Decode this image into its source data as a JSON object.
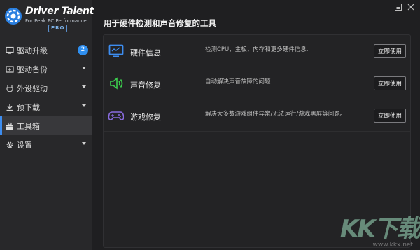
{
  "app": {
    "name": "Driver Talent",
    "tagline": "For Peak PC Performance",
    "edition": "PRO"
  },
  "titlebar": {
    "menu_icon": "menu-icon",
    "close_icon": "close-icon"
  },
  "sidebar": {
    "items": [
      {
        "label": "驱动升级",
        "icon": "monitor-icon",
        "badge": "2",
        "active": false
      },
      {
        "label": "驱动备份",
        "icon": "backup-icon",
        "caret": true,
        "active": false
      },
      {
        "label": "外设驱动",
        "icon": "plug-icon",
        "caret": true,
        "active": false
      },
      {
        "label": "预下载",
        "icon": "download-icon",
        "caret": true,
        "active": false
      },
      {
        "label": "工具箱",
        "icon": "toolbox-icon",
        "active": true
      },
      {
        "label": "设置",
        "icon": "gear-icon",
        "caret": true,
        "active": false
      }
    ]
  },
  "main": {
    "title": "用于硬件检测和声音修复的工具",
    "tools": [
      {
        "name": "硬件信息",
        "desc": "检测CPU，主板，内存和更多硬件信息.",
        "button": "立即使用",
        "icon": "hardware-monitor-icon"
      },
      {
        "name": "声音修复",
        "desc": "自动解决声音故障的问题",
        "button": "立即使用",
        "icon": "speaker-icon"
      },
      {
        "name": "游戏修复",
        "desc": "解决大多数游戏组件异常/无法运行/游戏黑屏等问题。",
        "button": "立即使用",
        "icon": "gamepad-icon"
      }
    ]
  },
  "watermark": {
    "text": "KK下载",
    "url": "www.kkx.net"
  },
  "colors": {
    "accent": "#3d8df0",
    "sound_green": "#3ccf4e",
    "game_purple": "#8a6ce0"
  }
}
